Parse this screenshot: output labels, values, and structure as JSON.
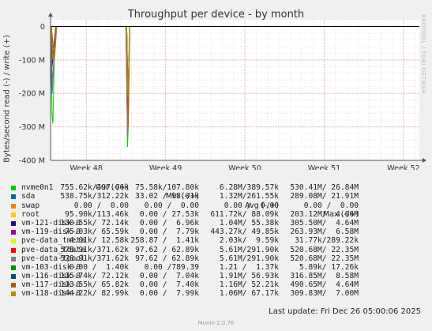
{
  "title": "Throughput per device - by month",
  "side_watermark": "RRDTOOL / TOBI OETIKER",
  "footer": {
    "last_update": "Last update: Fri Dec 26 05:00:06 2025",
    "munin": "Munin 2.0.76"
  },
  "colors": {
    "background": "#f0f0f0",
    "plot_bg": "#ffffff",
    "grid": "#e0b0b0",
    "zero_line": "#000000"
  },
  "legend_header": {
    "cur": "Cur (-/+)",
    "min": "Min (-/+)",
    "avg": "Avg (-/+)",
    "max": "Max (-/+)"
  },
  "legend": [
    {
      "name": "nvme0n1",
      "color": "#00cc00",
      "cur": "755.62k/497.66k",
      "min": "75.58k/107.80k",
      "avg": "6.28M/389.57k",
      "max": "530.41M/ 26.84M"
    },
    {
      "name": "sda",
      "color": "#0066b3",
      "cur": "538.75k/312.22k",
      "min": "33.02 / 98.01k",
      "avg": "1.32M/261.55k",
      "max": "289.08M/ 21.91M"
    },
    {
      "name": "swap",
      "color": "#ff8000",
      "cur": "0.00 /  0.00",
      "min": "0.00 /  0.00",
      "avg": "0.00 /  0.00",
      "max": "0.00 /  0.00"
    },
    {
      "name": "root",
      "color": "#ffcc00",
      "cur": "95.90k/113.46k",
      "min": "0.00 / 27.53k",
      "avg": "611.72k/ 88.09k",
      "max": "203.12M/  4.66M"
    },
    {
      "name": "vm-121-disk-0",
      "color": "#330099",
      "cur": "130.55k/ 72.14k",
      "min": "0.00 /  6.96k",
      "avg": "1.04M/ 55.38k",
      "max": "305.50M/  4.64M"
    },
    {
      "name": "vm-119-disk-0",
      "color": "#990099",
      "cur": "75.03k/ 65.59k",
      "min": "0.00 /  7.79k",
      "avg": "443.27k/ 49.85k",
      "max": "263.93M/  6.58M"
    },
    {
      "name": "pve-data_tmeta",
      "color": "#ccff00",
      "cur": "4.01k/ 12.58k",
      "min": "258.87 /  1.41k",
      "avg": "2.03k/  9.59k",
      "max": "31.77k/289.22k"
    },
    {
      "name": "pve-data_tdata",
      "color": "#ff0000",
      "cur": "578.91k/371.62k",
      "min": "97.62 / 62.89k",
      "avg": "5.61M/291.90k",
      "max": "520.68M/ 22.35M"
    },
    {
      "name": "pve-data-tpool",
      "color": "#808080",
      "cur": "578.91k/371.62k",
      "min": "97.62 / 62.89k",
      "avg": "5.61M/291.90k",
      "max": "520.68M/ 22.35M"
    },
    {
      "name": "vm-103-disk-0",
      "color": "#008f00",
      "cur": "0.00 /  1.40k",
      "min": "0.00 /789.39",
      "avg": "1.21 /  1.37k",
      "max": "5.89k/ 17.26k"
    },
    {
      "name": "vm-116-disk-0",
      "color": "#00487d",
      "cur": "115.74k/ 72.12k",
      "min": "0.00 /  7.04k",
      "avg": "1.91M/ 56.93k",
      "max": "316.85M/  8.58M"
    },
    {
      "name": "vm-117-disk-0",
      "color": "#b35a00",
      "cur": "113.55k/ 65.82k",
      "min": "0.00 /  7.40k",
      "avg": "1.16M/ 52.21k",
      "max": "490.65M/  4.64M"
    },
    {
      "name": "vm-118-disk-0",
      "color": "#b38f00",
      "cur": "144.22k/ 82.99k",
      "min": "0.00 /  7.99k",
      "avg": "1.06M/ 67.17k",
      "max": "309.83M/  7.00M"
    }
  ],
  "chart_data": {
    "type": "line",
    "title": "Throughput per device - by month",
    "ylabel": "Bytes/second read (-) / write (+)",
    "ylim": [
      -400000000,
      20000000
    ],
    "yticks": [
      0,
      -100000000,
      -200000000,
      -300000000,
      -400000000
    ],
    "ytick_labels": [
      "0",
      "-100 M",
      "-200 M",
      "-300 M",
      "-400 M"
    ],
    "x_range_weeks": [
      47.55,
      52.2
    ],
    "xticks": [
      48,
      49,
      50,
      51,
      52
    ],
    "xtick_labels": [
      "Week 48",
      "Week 49",
      "Week 50",
      "Week 51",
      "Week 52"
    ],
    "grid": true,
    "series": [
      {
        "name": "nvme0n1",
        "color": "#00cc00",
        "points": [
          [
            47.55,
            0
          ],
          [
            47.57,
            -270000000
          ],
          [
            47.58,
            -290000000
          ],
          [
            47.6,
            -80000000
          ],
          [
            47.61,
            -5000000
          ],
          [
            47.62,
            0
          ],
          [
            48.5,
            0
          ],
          [
            48.51,
            -100000000
          ],
          [
            48.52,
            -360000000
          ],
          [
            48.53,
            -300000000
          ],
          [
            48.54,
            -60000000
          ],
          [
            48.55,
            0
          ]
        ]
      },
      {
        "name": "sda",
        "color": "#0066b3",
        "points": [
          [
            47.55,
            0
          ],
          [
            47.56,
            -150000000
          ],
          [
            47.57,
            -200000000
          ],
          [
            47.6,
            -60000000
          ],
          [
            47.62,
            0
          ],
          [
            48.5,
            0
          ],
          [
            48.515,
            -210000000
          ],
          [
            48.53,
            -280000000
          ],
          [
            48.545,
            -30000000
          ],
          [
            48.55,
            0
          ]
        ]
      },
      {
        "name": "root",
        "color": "#ffcc00",
        "points": [
          [
            47.56,
            0
          ],
          [
            47.575,
            -110000000
          ],
          [
            47.59,
            -60000000
          ],
          [
            47.62,
            0
          ],
          [
            48.51,
            0
          ],
          [
            48.52,
            -150000000
          ],
          [
            48.535,
            -200000000
          ],
          [
            48.55,
            0
          ]
        ]
      },
      {
        "name": "vm-121-disk-0",
        "color": "#330099",
        "points": [
          [
            47.56,
            0
          ],
          [
            47.57,
            -120000000
          ],
          [
            47.6,
            -40000000
          ],
          [
            47.62,
            0
          ],
          [
            48.51,
            0
          ],
          [
            48.525,
            -250000000
          ],
          [
            48.54,
            -100000000
          ],
          [
            48.55,
            0
          ]
        ]
      },
      {
        "name": "vm-119-disk-0",
        "color": "#990099",
        "points": [
          [
            47.56,
            0
          ],
          [
            47.58,
            -90000000
          ],
          [
            47.61,
            -20000000
          ],
          [
            47.63,
            0
          ],
          [
            48.51,
            0
          ],
          [
            48.53,
            -220000000
          ],
          [
            48.55,
            0
          ]
        ]
      },
      {
        "name": "pve-data_tdata",
        "color": "#ff0000",
        "points": [
          [
            47.55,
            0
          ],
          [
            47.575,
            -180000000
          ],
          [
            47.6,
            -70000000
          ],
          [
            47.62,
            0
          ],
          [
            48.5,
            0
          ],
          [
            48.52,
            -330000000
          ],
          [
            48.54,
            -120000000
          ],
          [
            48.55,
            0
          ]
        ]
      },
      {
        "name": "pve-data-tpool",
        "color": "#808080",
        "points": [
          [
            47.55,
            0
          ],
          [
            47.575,
            -180000000
          ],
          [
            47.6,
            -70000000
          ],
          [
            47.62,
            0
          ],
          [
            48.5,
            0
          ],
          [
            48.52,
            -330000000
          ],
          [
            48.54,
            -120000000
          ],
          [
            48.55,
            0
          ]
        ]
      },
      {
        "name": "vm-116-disk-0",
        "color": "#00487d",
        "points": [
          [
            47.56,
            0
          ],
          [
            47.58,
            -100000000
          ],
          [
            47.61,
            -30000000
          ],
          [
            47.63,
            0
          ],
          [
            48.51,
            0
          ],
          [
            48.525,
            -200000000
          ],
          [
            48.55,
            0
          ]
        ]
      },
      {
        "name": "vm-117-disk-0",
        "color": "#b35a00",
        "points": [
          [
            47.56,
            0
          ],
          [
            47.6,
            -95000000
          ],
          [
            47.62,
            -30000000
          ],
          [
            47.63,
            0
          ],
          [
            48.51,
            0
          ],
          [
            48.53,
            -300000000
          ],
          [
            48.55,
            0
          ]
        ]
      },
      {
        "name": "vm-118-disk-0",
        "color": "#b38f00",
        "points": [
          [
            47.56,
            0
          ],
          [
            47.58,
            -100000000
          ],
          [
            47.61,
            -40000000
          ],
          [
            47.63,
            0
          ],
          [
            48.51,
            0
          ],
          [
            48.525,
            -210000000
          ],
          [
            48.55,
            0
          ]
        ]
      }
    ]
  }
}
